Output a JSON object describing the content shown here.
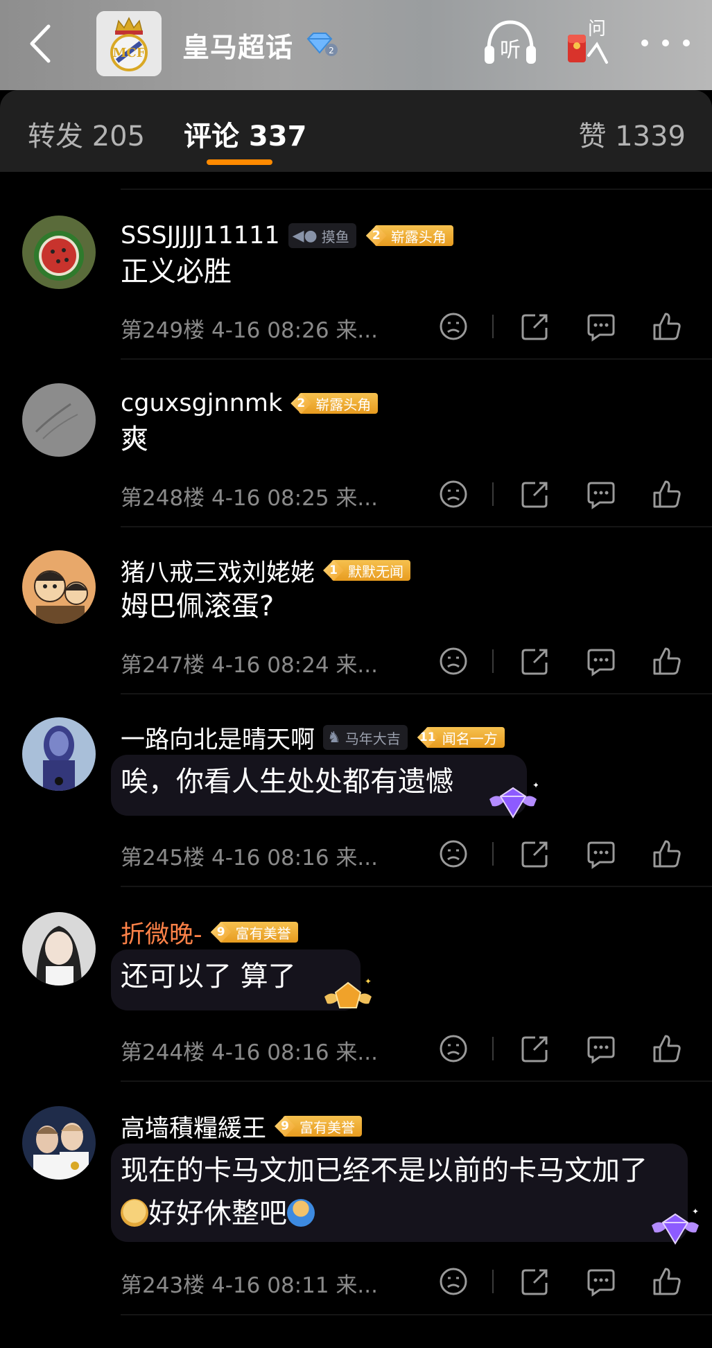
{
  "header": {
    "title": "皇马超话",
    "listen_label": "听",
    "ask_label": "问"
  },
  "tabs": {
    "repost": "转发 205",
    "comments": "评论 337",
    "likes": "赞 1339"
  },
  "comments": [
    {
      "name": "SSSJJJJJ11111",
      "tag": "摸鱼",
      "level": "2",
      "level_title": "崭露头角",
      "text": "正义必胜",
      "meta": "第249楼  4-16 08:26  来..."
    },
    {
      "name": "cguxsgjnnmk",
      "level": "2",
      "level_title": "崭露头角",
      "text": "爽",
      "meta": "第248楼  4-16 08:25  来..."
    },
    {
      "name": "猪八戒三戏刘姥姥",
      "level": "1",
      "level_title": "默默无闻",
      "text": "姆巴佩滚蛋?",
      "meta": "第247楼  4-16 08:24  来..."
    },
    {
      "name": "一路向北是晴天啊",
      "tag": "马年大吉",
      "level": "11",
      "level_title": "闻名一方",
      "text": "唉，你看人生处处都有遗憾",
      "meta": "第245楼  4-16 08:16  来..."
    },
    {
      "name": "折微晚-",
      "level": "9",
      "level_title": "富有美誉",
      "text": "还可以了 算了",
      "meta": "第244楼  4-16 08:16  来..."
    },
    {
      "name": "高墙積糧緩王",
      "level": "9",
      "level_title": "富有美誉",
      "text_line1": "现在的卡马文加已经不是以前的卡马文加了",
      "text_line2": "好好休整吧",
      "meta": "第243楼  4-16 08:11  来..."
    }
  ],
  "colors": {
    "accent": "#ff8a00",
    "level_tag": "#f0a22a",
    "highlight_name": "#ff8248"
  }
}
